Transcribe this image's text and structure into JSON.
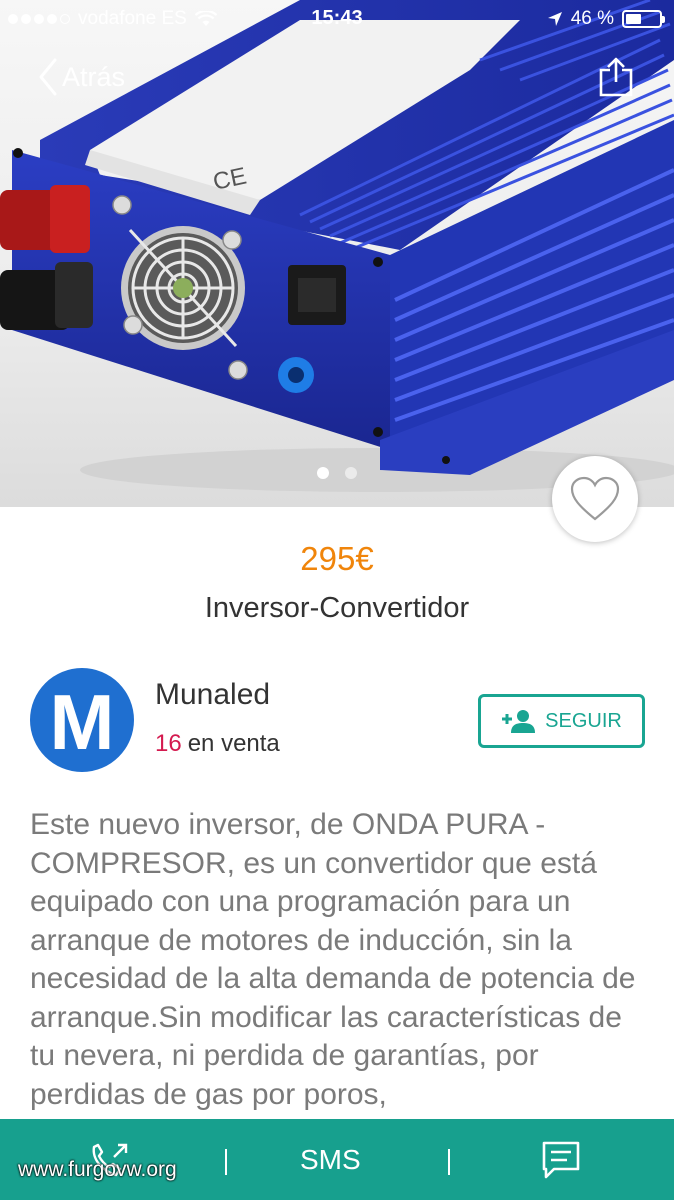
{
  "status_bar": {
    "carrier": "vodafone ES",
    "time": "15:43",
    "battery": "46 %",
    "battery_level": 0.46,
    "signal_bars_filled": 4,
    "signal_bars_total": 5
  },
  "nav": {
    "back_label": "Atrás"
  },
  "gallery": {
    "image_count": 2,
    "current_index": 0
  },
  "product": {
    "price": "295€",
    "title": "Inversor-Convertidor",
    "description": "Este nuevo inversor, de ONDA PURA - COMPRESOR, es un convertidor que está equipado con una programación para un arranque de motores de inducción, sin la necesidad de la alta demanda de potencia de arranque.Sin modificar las características de tu nevera, ni perdida de garantías, por perdidas de gas por poros,"
  },
  "seller": {
    "avatar_letter": "M",
    "name": "Munaled",
    "items_count": "16",
    "items_label": "en venta",
    "follow_label": "SEGUIR"
  },
  "bottom_bar": {
    "sms_label": "SMS",
    "watermark": "www.furgovw.org"
  },
  "colors": {
    "accent": "#17a08e",
    "price": "#f0850b",
    "count": "#d41a4f",
    "avatar": "#1f6fd0"
  }
}
